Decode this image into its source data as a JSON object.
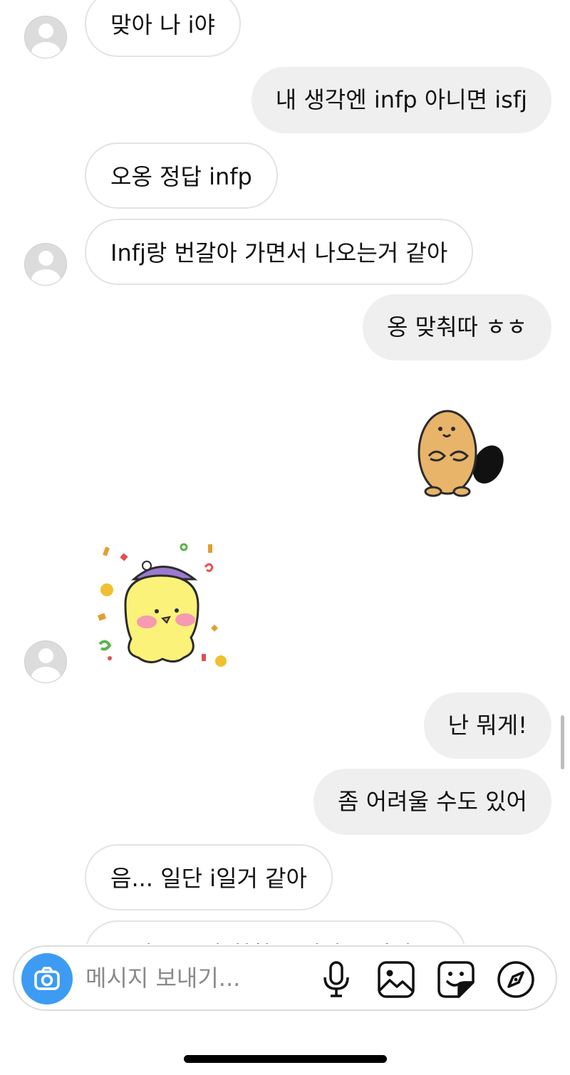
{
  "messages": [
    {
      "side": "in",
      "text": "맞아 나 i야"
    },
    {
      "side": "out",
      "text": "내 생각엔 infp 아니면 isfj"
    },
    {
      "side": "in",
      "text": "오옹 정답 infp"
    },
    {
      "side": "in",
      "text": "Infj랑 번갈아 가면서 나오는거 같아"
    },
    {
      "side": "out",
      "text": "옹 맞춰따 ㅎㅎ"
    },
    {
      "side": "out",
      "sticker": "beaver-sticker"
    },
    {
      "side": "in",
      "sticker": "yellow-chick-party-sticker"
    },
    {
      "side": "out",
      "text": "난 뭐게!"
    },
    {
      "side": "out",
      "text": "좀 어려울 수도 있어"
    },
    {
      "side": "in",
      "text": "음... 일단 i일거 같아"
    },
    {
      "side": "in",
      "text": "그리고 음악 취향 보니까... 아마 f?"
    }
  ],
  "composer": {
    "placeholder": "메시지 보내기...",
    "icons": [
      "camera-icon",
      "microphone-icon",
      "image-icon",
      "sticker-icon",
      "compass-icon"
    ]
  },
  "colors": {
    "outgoing_bubble": "#efefef",
    "incoming_border": "#e3e3e3",
    "camera_button": "#3d9bf3"
  }
}
